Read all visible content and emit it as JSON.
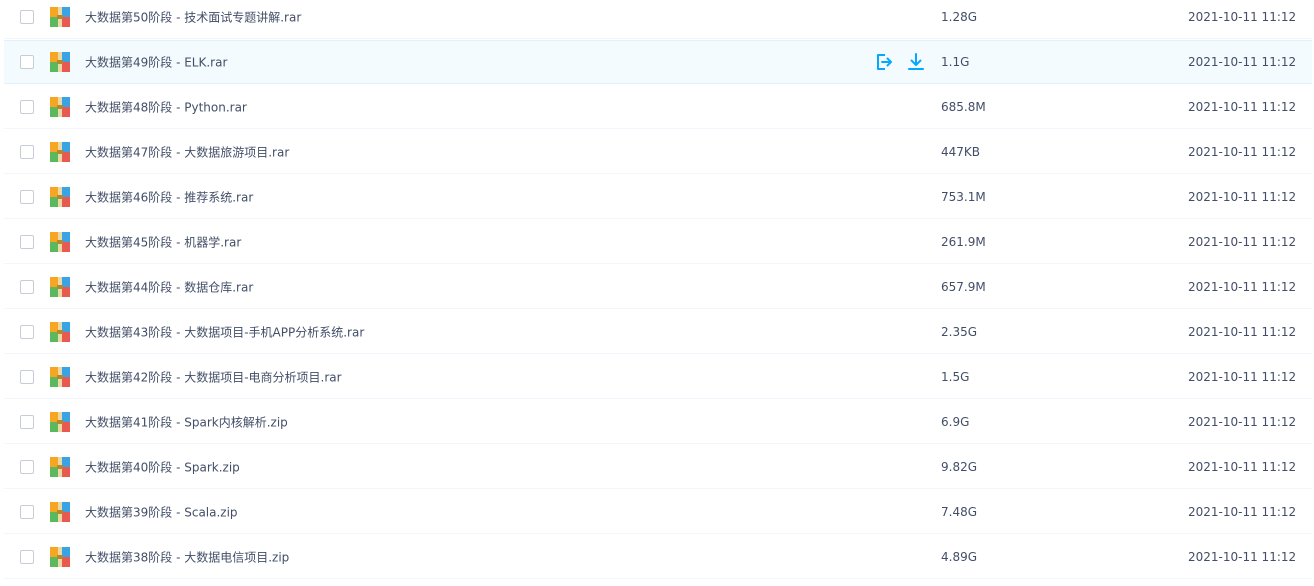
{
  "colors": {
    "text": "#424e67",
    "accent": "#06a7ff",
    "hover_bg": "#f4fbff"
  },
  "files": [
    {
      "name": "大数据第50阶段 - 技术面试专题讲解.rar",
      "size": "1.28G",
      "time": "2021-10-11 11:12",
      "icon": "archive-icon"
    },
    {
      "name": "大数据第49阶段 - ELK.rar",
      "size": "1.1G",
      "time": "2021-10-11 11:12",
      "icon": "archive-icon",
      "hovered": true
    },
    {
      "name": "大数据第48阶段 - Python.rar",
      "size": "685.8M",
      "time": "2021-10-11 11:12",
      "icon": "archive-icon"
    },
    {
      "name": "大数据第47阶段 - 大数据旅游项目.rar",
      "size": "447KB",
      "time": "2021-10-11 11:12",
      "icon": "archive-icon"
    },
    {
      "name": "大数据第46阶段 - 推荐系统.rar",
      "size": "753.1M",
      "time": "2021-10-11 11:12",
      "icon": "archive-icon"
    },
    {
      "name": "大数据第45阶段 - 机器学.rar",
      "size": "261.9M",
      "time": "2021-10-11 11:12",
      "icon": "archive-icon"
    },
    {
      "name": "大数据第44阶段 - 数据仓库.rar",
      "size": "657.9M",
      "time": "2021-10-11 11:12",
      "icon": "archive-icon"
    },
    {
      "name": "大数据第43阶段 - 大数据项目-手机APP分析系统.rar",
      "size": "2.35G",
      "time": "2021-10-11 11:12",
      "icon": "archive-icon"
    },
    {
      "name": "大数据第42阶段 - 大数据项目-电商分析项目.rar",
      "size": "1.5G",
      "time": "2021-10-11 11:12",
      "icon": "archive-icon"
    },
    {
      "name": "大数据第41阶段 - Spark内核解析.zip",
      "size": "6.9G",
      "time": "2021-10-11 11:12",
      "icon": "archive-icon"
    },
    {
      "name": "大数据第40阶段 - Spark.zip",
      "size": "9.82G",
      "time": "2021-10-11 11:12",
      "icon": "archive-icon"
    },
    {
      "name": "大数据第39阶段 - Scala.zip",
      "size": "7.48G",
      "time": "2021-10-11 11:12",
      "icon": "archive-icon"
    },
    {
      "name": "大数据第38阶段 - 大数据电信项目.zip",
      "size": "4.89G",
      "time": "2021-10-11 11:12",
      "icon": "archive-icon"
    }
  ],
  "row_actions": [
    {
      "icon": "share-icon"
    },
    {
      "icon": "download-icon"
    }
  ]
}
